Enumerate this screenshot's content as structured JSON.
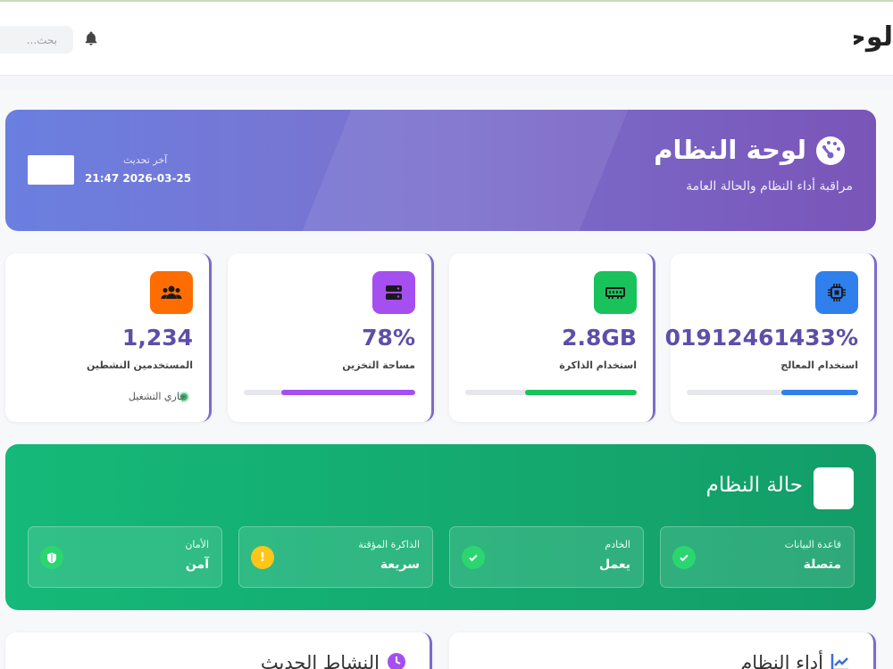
{
  "topbar": {
    "title": "لوحة النظام",
    "search_placeholder": "بحث..."
  },
  "hero": {
    "title": "لوحة النظام",
    "subtitle": "مراقبة أداء النظام والحالة العامة",
    "last_update_label": "آخر تحديث",
    "last_update_value": "21:47 2026-03-25"
  },
  "cards": [
    {
      "label": "استخدام المعالج",
      "value": "01912461433%",
      "bar_percent": 45,
      "color": "#2f80ed",
      "icon": "cpu-icon"
    },
    {
      "label": "استخدام الذاكرة",
      "value": "2.8GB",
      "bar_percent": 65,
      "color": "#19c25a",
      "icon": "memory-icon"
    },
    {
      "label": "مساحة التخزين",
      "value": "78%",
      "bar_percent": 78,
      "color": "#a54ff0",
      "icon": "storage-icon"
    },
    {
      "label": "المستخدمين النشطين",
      "value": "1,234",
      "status": "جاري التشغيل",
      "color": "#ff6d00",
      "icon": "users-icon"
    }
  ],
  "status": {
    "title": "حالة النظام",
    "tiles": [
      {
        "label": "قاعدة البيانات",
        "value": "متصلة",
        "icon": "check-icon"
      },
      {
        "label": "الخادم",
        "value": "يعمل",
        "icon": "check-icon"
      },
      {
        "label": "الذاكرة المؤقتة",
        "value": "سريعة",
        "icon": "warning-icon"
      },
      {
        "label": "الأمان",
        "value": "آمن",
        "icon": "shield-icon"
      }
    ]
  },
  "panels": {
    "performance_title": "أداء النظام",
    "activity_title": "النشاط الحديث"
  }
}
